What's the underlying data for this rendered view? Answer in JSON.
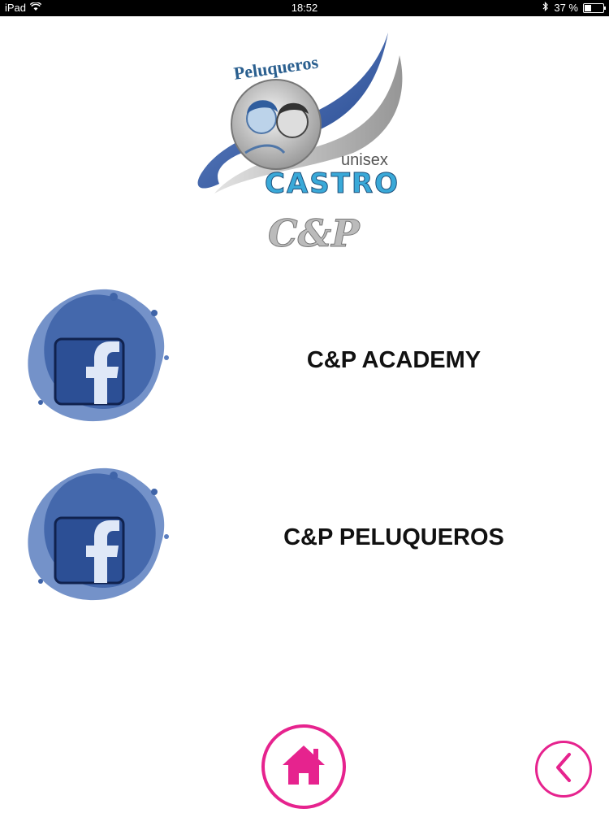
{
  "status_bar": {
    "device": "iPad",
    "time": "18:52",
    "battery_percent": 37,
    "battery_text": "37 %",
    "icons": [
      "wifi-icon",
      "bluetooth-icon",
      "battery-icon"
    ]
  },
  "logo": {
    "brand_top": "Peluqueros",
    "unisex": "unisex",
    "castro": "CASTRO",
    "monogram": "C&P"
  },
  "links": [
    {
      "label": "C&P ACADEMY",
      "icon": "facebook-icon"
    },
    {
      "label": "C&P PELUQUEROS",
      "icon": "facebook-icon"
    }
  ],
  "nav": {
    "home_icon": "home-icon",
    "back_icon": "chevron-left-icon",
    "accent_color": "#e6238e"
  },
  "colors": {
    "facebook_blue": "#3b5998",
    "splash_blue": "#3f64a8"
  }
}
